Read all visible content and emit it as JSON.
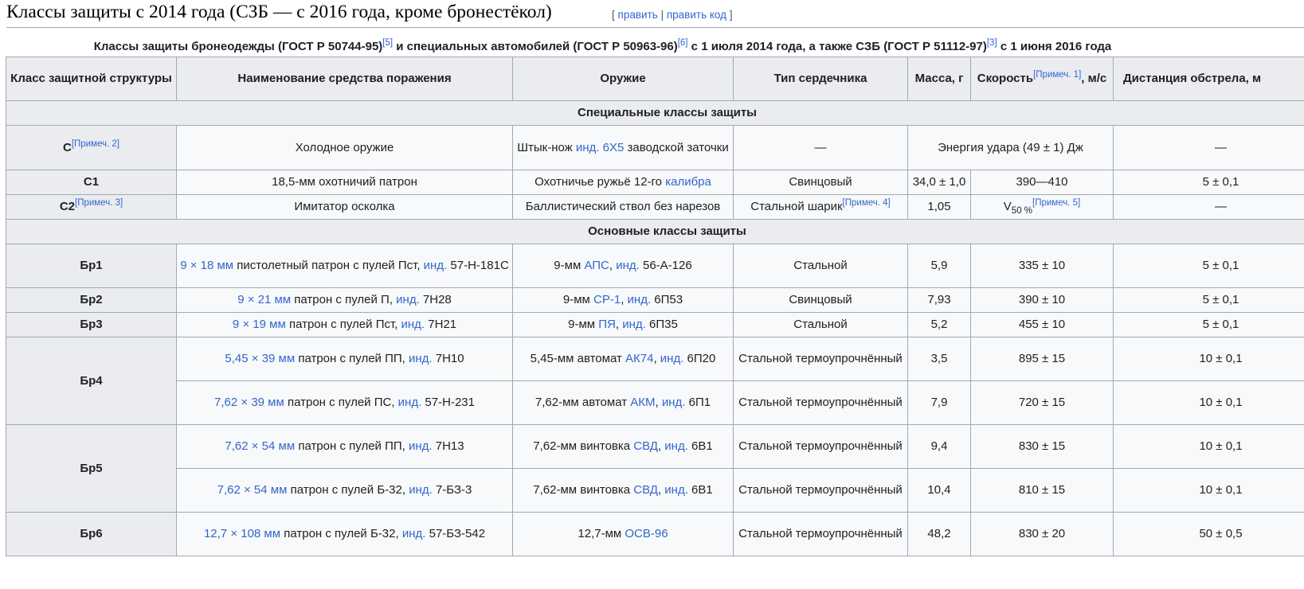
{
  "section": {
    "title": "Классы защиты с 2014 года (СЗБ — с 2016 года, кроме бронестёкол)",
    "edit_open": "[",
    "edit_label": "править",
    "edit_sep": "|",
    "edit_code_label": "править код",
    "edit_close": "]"
  },
  "caption": {
    "part1": "Классы защиты бронеодежды (ГОСТ Р 50744-95)",
    "ref1": "[5]",
    "part2": " и специальных автомобилей (ГОСТ Р 50963-96)",
    "ref2": "[6]",
    "part3": " с 1 июля 2014 года, а также СЗБ (ГОСТ Р 51112-97)",
    "ref3": "[3]",
    "part4": " с 1 июня 2016 года"
  },
  "headers": {
    "class": "Класс защитной структуры",
    "name": "Наименование средства поражения",
    "weapon": "Оружие",
    "core": "Тип сердечника",
    "mass": "Масса, г",
    "speed_pre": "Скорость",
    "speed_note": "[Примеч. 1]",
    "speed_post": ", м/с",
    "distance": "Дистанция обстрела, м"
  },
  "sections": {
    "special": "Специальные классы защиты",
    "main": "Основные классы защиты"
  },
  "rows": {
    "c": {
      "cls": "С",
      "cls_note": "[Примеч. 2]",
      "name": "Холодное оружие",
      "weapon_pre": "Штык-нож ",
      "weapon_link": "инд. 6Х5",
      "weapon_post": " заводской заточки",
      "core": "—",
      "energy": "Энергия удара (49 ± 1) Дж",
      "distance": "—"
    },
    "c1": {
      "cls": "С1",
      "name": "18,5-мм охотничий патрон",
      "weapon_pre": "Охотничье ружьё 12-го ",
      "weapon_link": "калибра",
      "core": "Свинцовый",
      "mass": "34,0 ± 1,0",
      "speed": "390—410",
      "distance": "5 ± 0,1"
    },
    "c2": {
      "cls": "С2",
      "cls_note": "[Примеч. 3]",
      "name": "Имитатор осколка",
      "weapon": "Баллистический ствол без нарезов",
      "core": "Стальной шарик",
      "core_note": "[Примеч. 4]",
      "mass": "1,05",
      "speed_v": "V",
      "speed_sub": "50 %",
      "speed_note": "[Примеч. 5]",
      "distance": "—"
    },
    "br1": {
      "cls": "Бр1",
      "cal_link": "9 × 18 мм",
      "name_mid": " пистолетный патрон с пулей Пст, ",
      "ind_link": "инд.",
      "ind_code": " 57-Н-181С",
      "weapon_pre": "9-мм ",
      "weapon_link": "АПС",
      "weapon_sep": ", ",
      "weapon_ind": "инд.",
      "weapon_code": " 56-А-126",
      "core": "Стальной",
      "mass": "5,9",
      "speed": "335 ± 10",
      "distance": "5 ± 0,1"
    },
    "br2": {
      "cls": "Бр2",
      "cal_link": "9 × 21 мм",
      "name_mid": " патрон с пулей П, ",
      "ind_link": "инд.",
      "ind_code": " 7Н28",
      "weapon_pre": "9-мм ",
      "weapon_link": "СР-1",
      "weapon_sep": ", ",
      "weapon_ind": "инд.",
      "weapon_code": " 6П53",
      "core": "Свинцовый",
      "mass": "7,93",
      "speed": "390 ± 10",
      "distance": "5 ± 0,1"
    },
    "br3": {
      "cls": "Бр3",
      "cal_link": "9 × 19 мм",
      "name_mid": " патрон с пулей Пст, ",
      "ind_link": "инд.",
      "ind_code": " 7Н21",
      "weapon_pre": "9-мм ",
      "weapon_link": "ПЯ",
      "weapon_sep": ", ",
      "weapon_ind": "инд.",
      "weapon_code": " 6П35",
      "core": "Стальной",
      "mass": "5,2",
      "speed": "455 ± 10",
      "distance": "5 ± 0,1"
    },
    "br4a": {
      "cls": "Бр4",
      "cal_link": "5,45 × 39 мм",
      "name_mid": " патрон с пулей ПП, ",
      "ind_link": "инд.",
      "ind_code": " 7Н10",
      "weapon_pre": "5,45-мм автомат ",
      "weapon_link": "АК74",
      "weapon_sep": ", ",
      "weapon_ind": "инд.",
      "weapon_code": " 6П20",
      "core": "Стальной термоупрочнённый",
      "mass": "3,5",
      "speed": "895 ± 15",
      "distance": "10 ± 0,1"
    },
    "br4b": {
      "cal_link": "7,62 × 39 мм",
      "name_mid": " патрон с пулей ПС, ",
      "ind_link": "инд.",
      "ind_code": " 57-Н-231",
      "weapon_pre": "7,62-мм автомат ",
      "weapon_link": "АКМ",
      "weapon_sep": ", ",
      "weapon_ind": "инд.",
      "weapon_code": " 6П1",
      "core": "Стальной термоупрочнённый",
      "mass": "7,9",
      "speed": "720 ± 15",
      "distance": "10 ± 0,1"
    },
    "br5a": {
      "cls": "Бр5",
      "cal_link": "7,62 × 54 мм",
      "name_mid": " патрон с пулей ПП, ",
      "ind_link": "инд.",
      "ind_code": " 7Н13",
      "weapon_pre": "7,62-мм винтовка ",
      "weapon_link": "СВД",
      "weapon_sep": ", ",
      "weapon_ind": "инд.",
      "weapon_code": " 6В1",
      "core": "Стальной термоупрочнённый",
      "mass": "9,4",
      "speed": "830 ± 15",
      "distance": "10 ± 0,1"
    },
    "br5b": {
      "cal_link": "7,62 × 54 мм",
      "name_mid": " патрон с пулей Б-32, ",
      "ind_link": "инд.",
      "ind_code": " 7-БЗ-3",
      "weapon_pre": "7,62-мм винтовка ",
      "weapon_link": "СВД",
      "weapon_sep": ", ",
      "weapon_ind": "инд.",
      "weapon_code": " 6В1",
      "core": "Стальной термоупрочнённый",
      "mass": "10,4",
      "speed": "810 ± 15",
      "distance": "10 ± 0,1"
    },
    "br6": {
      "cls": "Бр6",
      "cal_link": "12,7 × 108 мм",
      "name_mid": " патрон с пулей Б-32, ",
      "ind_link": "инд.",
      "ind_code": " 57-БЗ-542",
      "weapon_pre": "12,7-мм ",
      "weapon_link": "ОСВ-96",
      "core": "Стальной термоупрочнённый",
      "mass": "48,2",
      "speed": "830 ± 20",
      "distance": "50 ± 0,5"
    }
  }
}
